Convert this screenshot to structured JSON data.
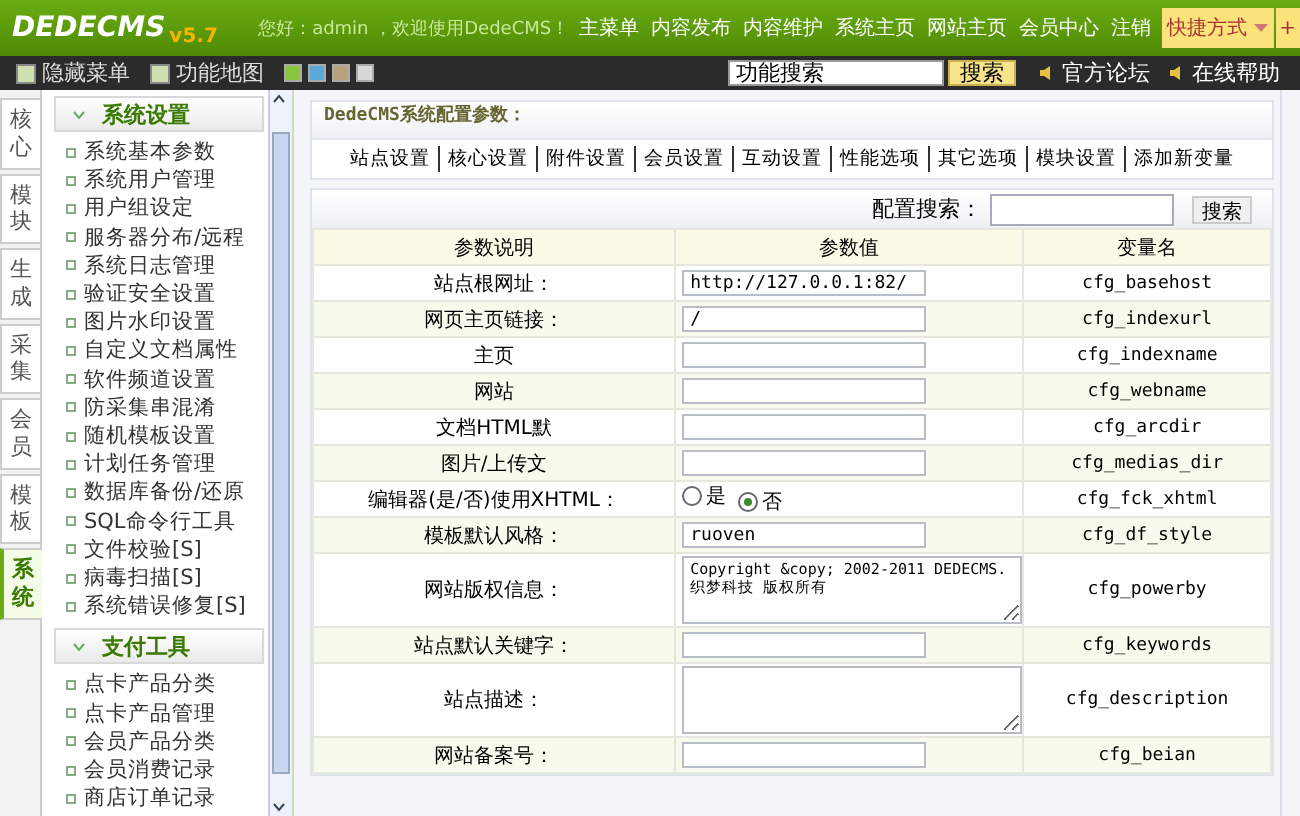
{
  "header": {
    "logo": "DEDECMS",
    "version": "v5.7",
    "greeting": "您好：admin ，欢迎使用DedeCMS！",
    "menu": [
      "主菜单",
      "内容发布",
      "内容维护",
      "系统主页",
      "网站主页",
      "会员中心",
      "注销"
    ],
    "shortcut": "快捷方式",
    "plus": "+"
  },
  "toolbar": {
    "hide_menu": "隐藏菜单",
    "function_map": "功能地图",
    "themes": [
      {
        "color": "#8cc63f"
      },
      {
        "color": "#5aa9d6"
      },
      {
        "color": "#b9a27c"
      },
      {
        "color": "#d8d8d8"
      }
    ],
    "search": {
      "value": "功能搜索"
    },
    "search_button": "搜索",
    "links": [
      "官方论坛",
      "在线帮助"
    ]
  },
  "side_tabs": [
    {
      "label": "核心",
      "selected": false
    },
    {
      "label": "模块",
      "selected": false
    },
    {
      "label": "生成",
      "selected": false
    },
    {
      "label": "采集",
      "selected": false
    },
    {
      "label": "会员",
      "selected": false
    },
    {
      "label": "模板",
      "selected": false
    },
    {
      "label": "系统",
      "selected": true
    }
  ],
  "sidebar": [
    {
      "title": "系统设置",
      "expanded": true,
      "items": [
        "系统基本参数",
        "系统用户管理",
        "用户组设定",
        "服务器分布/远程",
        "系统日志管理",
        "验证安全设置",
        "图片水印设置",
        "自定义文档属性",
        "软件频道设置",
        "防采集串混淆",
        "随机模板设置",
        "计划任务管理",
        "数据库备份/还原",
        "SQL命令行工具",
        "文件校验[S]",
        "病毒扫描[S]",
        "系统错误修复[S]"
      ]
    },
    {
      "title": "支付工具",
      "expanded": true,
      "items": [
        "点卡产品分类",
        "点卡产品管理",
        "会员产品分类",
        "会员消费记录",
        "商店订单记录"
      ]
    }
  ],
  "config": {
    "title": "DedeCMS系统配置参数：",
    "tabs": [
      "站点设置",
      "核心设置",
      "附件设置",
      "会员设置",
      "互动设置",
      "性能选项",
      "其它选项",
      "模块设置",
      "添加新变量"
    ],
    "search_label": "配置搜索：",
    "search_button": "搜索",
    "columns": [
      "参数说明",
      "参数值",
      "变量名"
    ],
    "rows": [
      {
        "kind": "input",
        "label": "站点根网址：",
        "value": "http://127.0.0.1:82/",
        "variable": "cfg_basehost"
      },
      {
        "kind": "input",
        "label": "网页主页链接：",
        "value": "/",
        "variable": "cfg_indexurl"
      },
      {
        "kind": "input",
        "label": "主页",
        "variable": "cfg_indexname"
      },
      {
        "kind": "input",
        "label": "网站",
        "variable": "cfg_webname"
      },
      {
        "kind": "input",
        "label": "文档HTML默",
        "variable": "cfg_arcdir"
      },
      {
        "kind": "input",
        "label": "图片/上传文",
        "variable": "cfg_medias_dir"
      },
      {
        "kind": "radio",
        "label": "编辑器(是/否)使用XHTML：",
        "options": [
          {
            "label": "是",
            "selected": false
          },
          {
            "label": "否",
            "selected": true
          }
        ],
        "variable": "cfg_fck_xhtml"
      },
      {
        "kind": "input",
        "label": "模板默认风格：",
        "value": "ruoven",
        "variable": "cfg_df_style"
      },
      {
        "kind": "textarea",
        "label": "网站版权信息：",
        "value": "Copyright &copy; 2002-2011 DEDECMS.\n织梦科技 版权所有",
        "variable": "cfg_powerby"
      },
      {
        "kind": "input",
        "label": "站点默认关键字：",
        "variable": "cfg_keywords"
      },
      {
        "kind": "textarea",
        "label": "站点描述：",
        "variable": "cfg_description"
      },
      {
        "kind": "input",
        "label": "网站备案号：",
        "variable": "cfg_beian"
      }
    ]
  }
}
